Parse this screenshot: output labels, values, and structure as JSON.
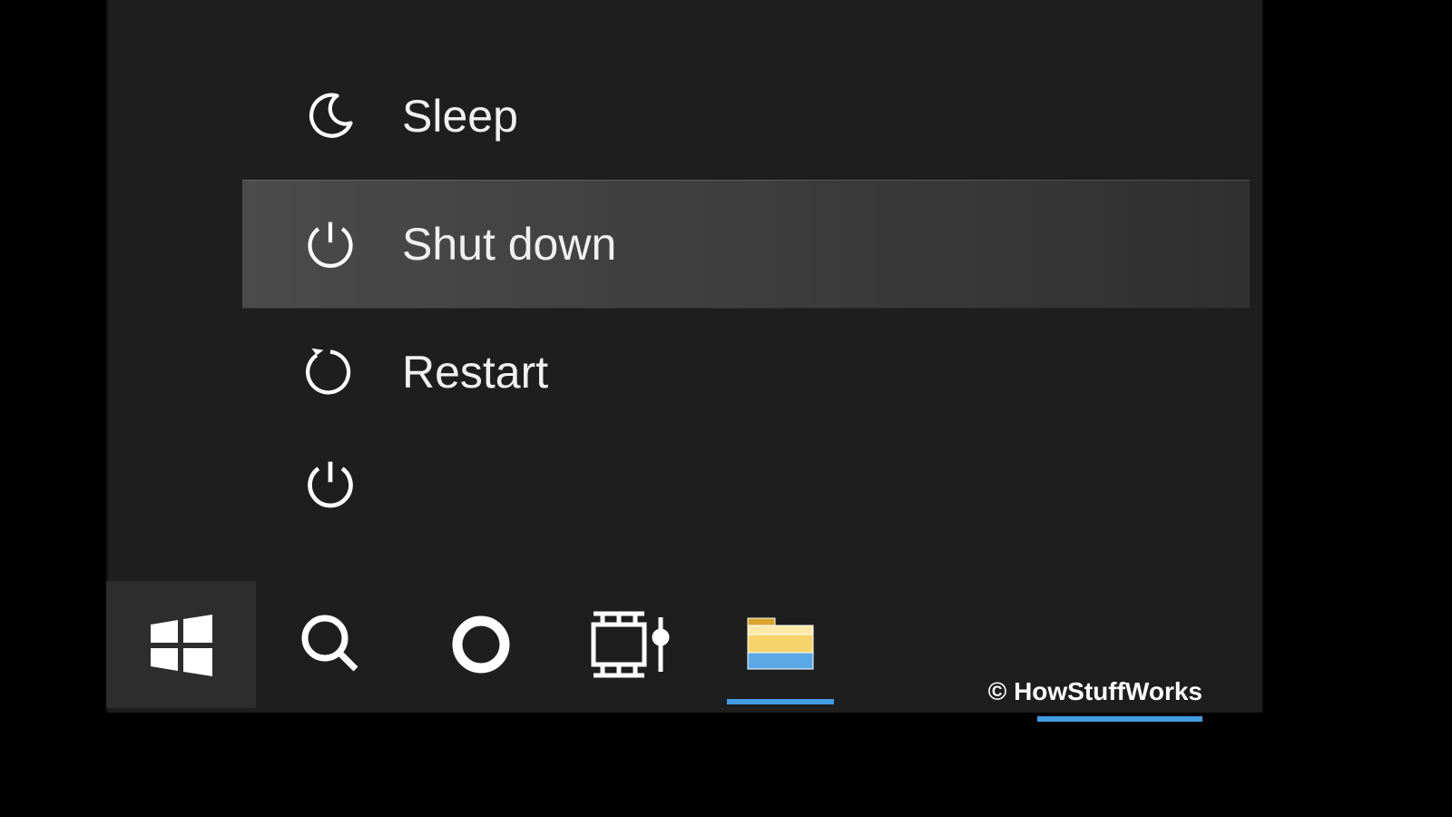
{
  "power_menu": {
    "items": [
      {
        "label": "Sleep",
        "icon": "moon",
        "highlighted": false
      },
      {
        "label": "Shut down",
        "icon": "power",
        "highlighted": true
      },
      {
        "label": "Restart",
        "icon": "restart",
        "highlighted": false
      }
    ]
  },
  "taskbar": {
    "items": [
      {
        "name": "start",
        "icon": "windows",
        "active": false
      },
      {
        "name": "search",
        "icon": "search",
        "active": false
      },
      {
        "name": "cortana",
        "icon": "cortana",
        "active": false
      },
      {
        "name": "task-view",
        "icon": "task-view",
        "active": false
      },
      {
        "name": "file-explorer",
        "icon": "file-explorer",
        "active": true
      }
    ]
  },
  "credit": "© HowStuffWorks"
}
